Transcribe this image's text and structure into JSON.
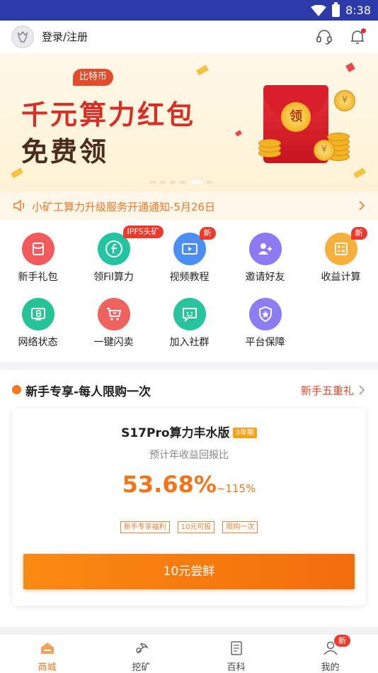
{
  "statusbar": {
    "time": "8:38",
    "wifi_icon": "wifi-icon",
    "battery_icon": "battery-icon"
  },
  "header": {
    "login_label": "登录/注册",
    "avatar_icon": "avatar-icon",
    "service_icon": "headset-icon",
    "notify_icon": "bell-icon"
  },
  "banner": {
    "tag": "比特币",
    "title": "千元算力红包",
    "subtitle": "免费领",
    "seal_text": "领",
    "coin_symbol": "¥"
  },
  "notice": {
    "text": "小矿工算力升级服务开通通知-5月26日"
  },
  "grid": [
    {
      "label": "新手礼包",
      "icon": "gift-icon",
      "color": "#f15b5b",
      "badge": ""
    },
    {
      "label": "领Fil算力",
      "icon": "filecoin-icon",
      "color": "#23c4a1",
      "badge": "IPFS头矿"
    },
    {
      "label": "视频教程",
      "icon": "video-icon",
      "color": "#4b8ff5",
      "badge": "新"
    },
    {
      "label": "邀请好友",
      "icon": "add-user-icon",
      "color": "#8e79f4",
      "badge": ""
    },
    {
      "label": "收益计算",
      "icon": "calculator-icon",
      "color": "#f8b03c",
      "badge": "新"
    },
    {
      "label": "网络状态",
      "icon": "bitcoin-icon",
      "color": "#25c397",
      "badge": ""
    },
    {
      "label": "一键闪卖",
      "icon": "cart-icon",
      "color": "#f0625d",
      "badge": ""
    },
    {
      "label": "加入社群",
      "icon": "chat-icon",
      "color": "#27c49b",
      "badge": ""
    },
    {
      "label": "平台保障",
      "icon": "shield-icon",
      "color": "#8d7cf2",
      "badge": ""
    }
  ],
  "section": {
    "title": "新手专享-每人限购一次",
    "link": "新手五重礼"
  },
  "product": {
    "name": "S17Pro算力丰水版",
    "period_tag": "3年期",
    "rate_label": "预计年收益回报比",
    "rate": "53.68%",
    "rate_max": "~115%",
    "tags": [
      "新手专享福利",
      "10元可投",
      "限购一次"
    ],
    "button_label": "10元尝鲜"
  },
  "bottom_nav": [
    {
      "label": "商城",
      "icon": "home-icon",
      "active": true,
      "badge": ""
    },
    {
      "label": "挖矿",
      "icon": "pickaxe-icon",
      "active": false,
      "badge": ""
    },
    {
      "label": "百科",
      "icon": "document-icon",
      "active": false,
      "badge": ""
    },
    {
      "label": "我的",
      "icon": "user-icon",
      "active": false,
      "badge": "新"
    }
  ],
  "colors": {
    "accent": "#f2751c",
    "status_bar": "#2b3aa8",
    "banner_red": "#d72f25",
    "badge_red": "#ec3a2c"
  }
}
